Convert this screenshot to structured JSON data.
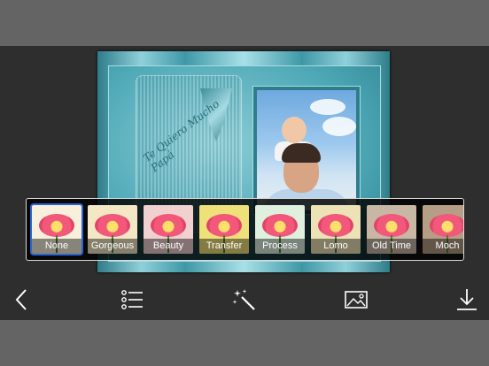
{
  "editor": {
    "frame_script_text": "Te Quiero Mucho Papá"
  },
  "filters": {
    "items": [
      {
        "label": "None",
        "tint": "#f6f0dc",
        "selected": true
      },
      {
        "label": "Gorgeous",
        "tint": "#f3e7c4",
        "selected": false
      },
      {
        "label": "Beauty",
        "tint": "#f1d0d0",
        "selected": false
      },
      {
        "label": "Transfer",
        "tint": "#f0e07a",
        "selected": false
      },
      {
        "label": "Process",
        "tint": "#dff0de",
        "selected": false
      },
      {
        "label": "Lomo",
        "tint": "#ece2b5",
        "selected": false
      },
      {
        "label": "Old Time",
        "tint": "#c9b7a6",
        "selected": false
      },
      {
        "label": "Moch",
        "tint": "#b59d86",
        "selected": false
      }
    ]
  },
  "toolbar": {
    "icons": [
      "back-chevron-icon",
      "list-icon",
      "magic-wand-icon",
      "image-icon",
      "download-icon"
    ]
  },
  "colors": {
    "selection": "#2b63d6",
    "frame_accent": "#4da8b6"
  }
}
